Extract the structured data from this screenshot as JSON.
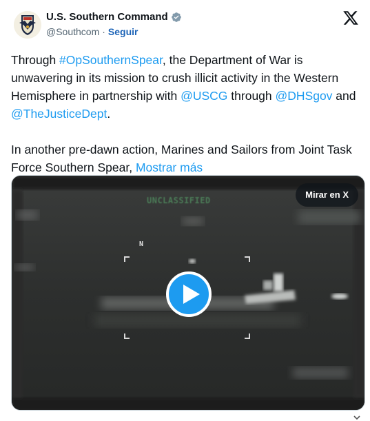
{
  "account": {
    "display_name": "U.S. Southern Command",
    "handle": "@Southcom",
    "separator": "·",
    "follow_label": "Seguir",
    "verified_icon": "verified-badge-icon",
    "avatar_icon": "southcom-seal-icon"
  },
  "tweet": {
    "p1_a": "Through ",
    "p1_hashtag": "#OpSouthernSpear",
    "p1_b": ", the Department of War is unwavering in its mission to crush illicit activity in the Western Hemisphere in partnership with ",
    "p1_mention1": "@USCG",
    "p1_c": " through ",
    "p1_mention2": "@DHSgov",
    "p1_d": " and ",
    "p1_mention3": "@TheJusticeDept",
    "p1_e": ".",
    "p2_text": "In another pre-dawn action, Marines and Sailors from Joint Task Force Southern Spear, ",
    "show_more": "Mostrar más"
  },
  "media": {
    "watch_label": "Mirar en X",
    "classification": "UNCLASSIFIED",
    "north_marker": "N",
    "play_icon": "play-icon"
  },
  "colors": {
    "link": "#1d9bf0",
    "follow": "#1d64b7",
    "play_button": "#1d9bf0",
    "verified": "#829aab"
  }
}
